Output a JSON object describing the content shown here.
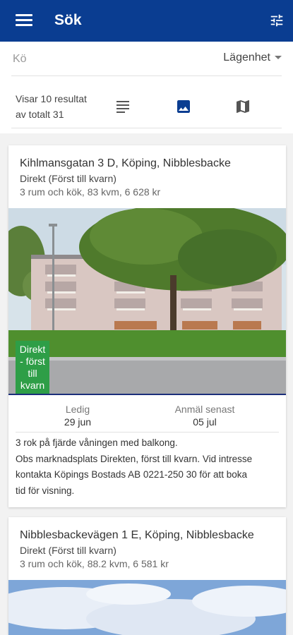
{
  "appbar": {
    "title": "Sök",
    "menu_icon": "menu-icon",
    "filter_icon": "tune-icon",
    "color": "#0a3d91"
  },
  "search": {
    "queue_label": "Kö",
    "type_value": "Lägenhet",
    "results_line1": "Visar 10 resultat",
    "results_line2": "av totalt 31",
    "view_icons": [
      "list-icon",
      "image-icon",
      "map-icon"
    ]
  },
  "listings": [
    {
      "address": "Kihlmansgatan 3 D, Köping, Nibblesbacke",
      "type": "Direkt (Först till kvarn)",
      "size": "3 rum och kök, 83 kvm, 6 628 kr",
      "badge_line1": "Direkt",
      "badge_line2": "- först",
      "badge_line3": "till",
      "badge_line4": "kvarn",
      "ledig_label": "Ledig",
      "ledig_value": "29 jun",
      "anmal_label": "Anmäl senast",
      "anmal_value": "05 jul",
      "desc_line1": "3 rok på fjärde våningen med balkong.",
      "desc_line2": "Obs marknadsplats Direkten, först till kvarn. Vid intresse",
      "desc_line3": "kontakta Köpings Bostads AB 0221-250 30 för att boka",
      "desc_line4": "tid för visning."
    },
    {
      "address": "Nibblesbackevägen 1 E, Köping, Nibblesbacke",
      "type": "Direkt (Först till kvarn)",
      "size": "3 rum och kök, 88.2 kvm, 6 581 kr"
    }
  ]
}
